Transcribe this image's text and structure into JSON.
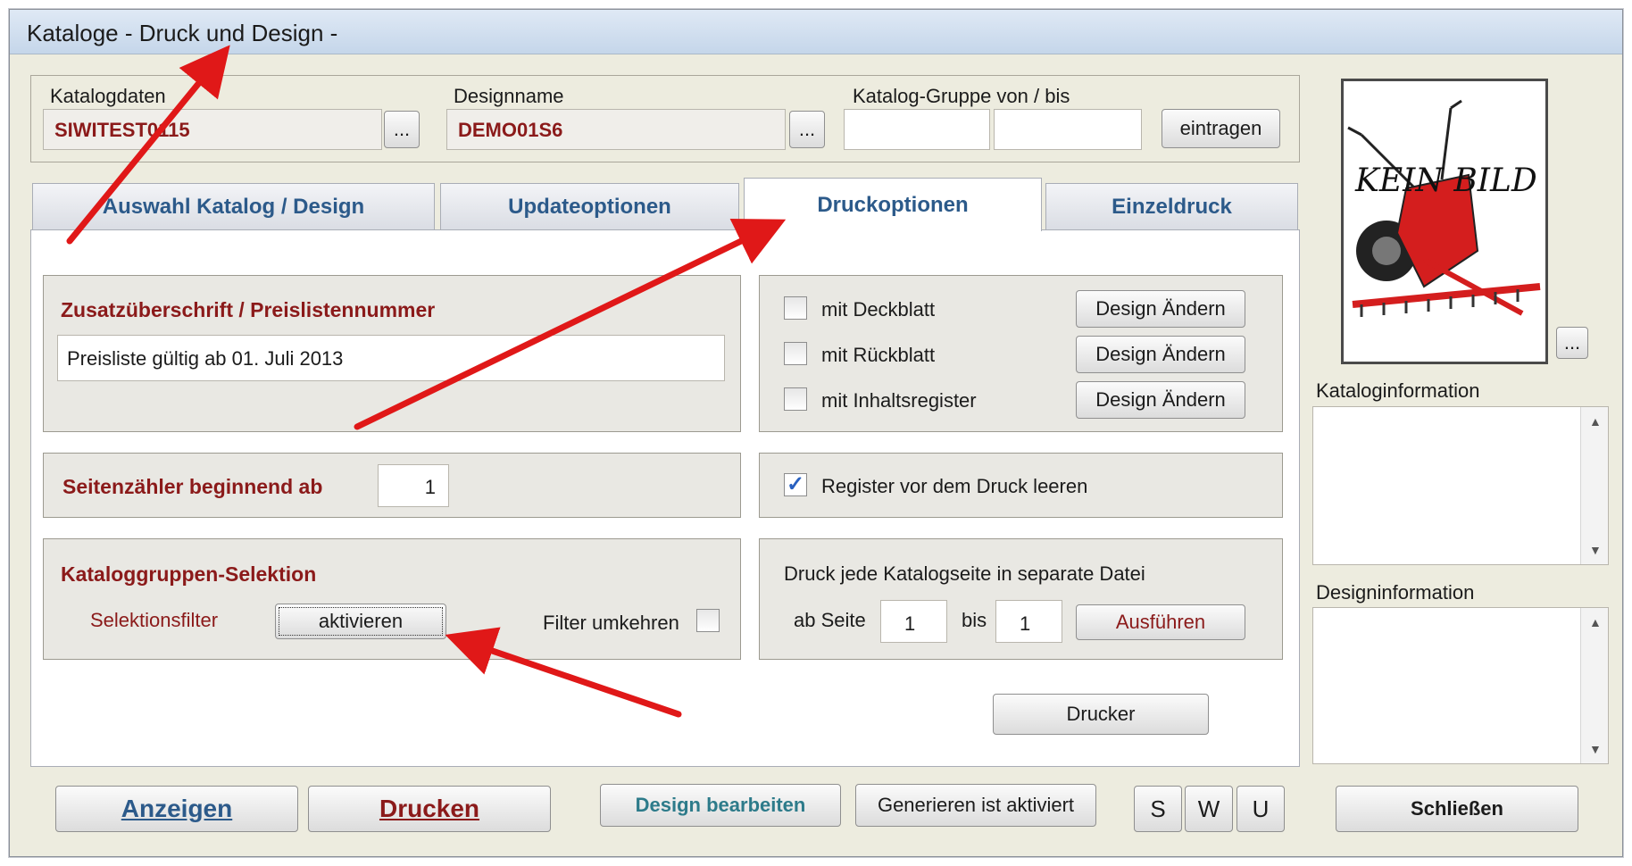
{
  "window": {
    "title": "Kataloge  -  Druck und Design  -"
  },
  "header": {
    "katalogdaten_label": "Katalogdaten",
    "katalogdaten_value": "SIWITEST0115",
    "designname_label": "Designname",
    "designname_value": "DEMO01S6",
    "gruppe_label": "Katalog-Gruppe von / bis",
    "gruppe_von": "",
    "gruppe_bis": "",
    "browse_label": "...",
    "eintragen_label": "eintragen"
  },
  "tabs": [
    {
      "label": "Auswahl Katalog / Design"
    },
    {
      "label": "Updateoptionen"
    },
    {
      "label": "Druckoptionen"
    },
    {
      "label": "Einzeldruck"
    }
  ],
  "druck": {
    "zusatz_title": "Zusatzüberschrift / Preislistennummer",
    "zusatz_value": "Preisliste gültig ab 01. Juli 2013",
    "seiten_title": "Seitenzähler beginnend ab",
    "seiten_value": "1",
    "selektion_title": "Kataloggruppen-Selektion",
    "selektionsfilter_label": "Selektionsfilter",
    "aktivieren_label": "aktivieren",
    "filter_umkehren_label": "Filter umkehren",
    "options": [
      {
        "label": "mit Deckblatt",
        "button": "Design Ändern"
      },
      {
        "label": "mit Rückblatt",
        "button": "Design Ändern"
      },
      {
        "label": "mit Inhaltsregister",
        "button": "Design Ändern"
      }
    ],
    "register_label": "Register vor dem Druck leeren",
    "separate_title": "Druck jede Katalogseite in separate Datei",
    "ab_seite_label": "ab Seite",
    "ab_seite_value": "1",
    "bis_label": "bis",
    "bis_value": "1",
    "ausfuehren_label": "Ausführen",
    "drucker_label": "Drucker"
  },
  "side": {
    "image_text": "KEIN BILD",
    "kataloginfo_label": "Kataloginformation",
    "designinfo_label": "Designinformation",
    "browse_label": "..."
  },
  "footer": {
    "anzeigen_label": "Anzeigen",
    "drucken_label": "Drucken",
    "design_bearbeiten_label": "Design bearbeiten",
    "generieren_label": "Generieren ist aktiviert",
    "s_label": "S",
    "w_label": "W",
    "u_label": "U",
    "schliessen_label": "Schließen"
  },
  "colors": {
    "accent_red": "#8b1a1a",
    "tab_blue": "#2c5a8a",
    "arrow": "#e01818"
  }
}
